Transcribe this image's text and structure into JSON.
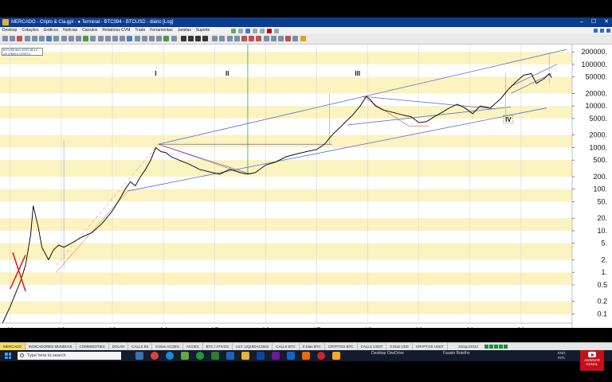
{
  "window": {
    "title": "MERCADO - Cripto & Cia.gpl - ● Terminal - BTC394 - BTCUSD - diário [Log]",
    "controls": [
      "–",
      "☐",
      "✕"
    ]
  },
  "menu": [
    "Desktop",
    "Cotações",
    "Gráficos",
    "Notícias",
    "Calculos",
    "Relatórios CVM",
    "Trade",
    "Ferramentas",
    "Janelas",
    "Suporte"
  ],
  "infobox": {
    "line1": "BTCUSD 6hH 40767.58 1.0",
    "line2": "CH 47809.3 | 47997.4"
  },
  "chart_data": {
    "type": "line",
    "title": "",
    "scale": "log",
    "x_ticks": [
      "11",
      "12",
      "13",
      "14",
      "15",
      "16",
      "17",
      "18",
      "19",
      "20",
      "21"
    ],
    "y_ticks": [
      "200000.",
      "100000.",
      "50000.",
      "20000.",
      "10000.",
      "5000.",
      "2000.",
      "1000.",
      "500.",
      "200.",
      "100.",
      "50.",
      "20.",
      "10.",
      "5.",
      "2.",
      "1.",
      "0.5",
      "0.2",
      "0.1"
    ],
    "y_tick_values": [
      200000,
      100000,
      50000,
      20000,
      10000,
      5000,
      2000,
      1000,
      500,
      200,
      100,
      50,
      20,
      10,
      5,
      2,
      1,
      0.5,
      0.2,
      0.1
    ],
    "ylim": [
      0.06,
      300000
    ],
    "xlim": [
      10.8,
      22
    ],
    "wave_labels": [
      "I",
      "II",
      "III",
      "IV"
    ],
    "series": [
      {
        "x": [
          10.85,
          11.0,
          11.1,
          11.2,
          11.3,
          11.4,
          11.45,
          11.55,
          11.62,
          11.75,
          11.85,
          11.95,
          12.05,
          12.2,
          12.4,
          12.6,
          12.8,
          13.0,
          13.15,
          13.25,
          13.35,
          13.45,
          13.55,
          13.65,
          13.75,
          13.85,
          13.95,
          14.05,
          14.15,
          14.3,
          14.5,
          14.7,
          14.9,
          15.1,
          15.3,
          15.5,
          15.65,
          15.8,
          16.0,
          16.2,
          16.4,
          16.6,
          16.8,
          17.0,
          17.15,
          17.3,
          17.45,
          17.55,
          17.7,
          17.85,
          17.97,
          18.05,
          18.15,
          18.3,
          18.5,
          18.7,
          18.85,
          19.0,
          19.15,
          19.3,
          19.45,
          19.6,
          19.75,
          19.9,
          20.05,
          20.2,
          20.4,
          20.6,
          20.75,
          20.9,
          21.05,
          21.2,
          21.3,
          21.45,
          21.55,
          21.6
        ],
        "y": [
          0.06,
          0.15,
          0.3,
          0.6,
          1.5,
          8,
          40,
          12,
          4,
          2,
          3.5,
          4.5,
          4,
          5,
          7,
          9,
          15,
          30,
          60,
          100,
          150,
          120,
          200,
          300,
          500,
          1000,
          800,
          750,
          600,
          500,
          400,
          300,
          260,
          230,
          300,
          250,
          230,
          250,
          380,
          450,
          600,
          700,
          800,
          900,
          1200,
          2000,
          3000,
          4000,
          6000,
          10000,
          17000,
          14000,
          10000,
          8000,
          7000,
          6000,
          5500,
          4000,
          4200,
          5500,
          7000,
          9000,
          11000,
          9000,
          6500,
          10000,
          9000,
          15000,
          25000,
          38000,
          55000,
          60000,
          35000,
          45000,
          60000,
          48000
        ]
      }
    ]
  },
  "bottom_tabs": [
    "MERCADO",
    "INDICADORES MUNDIAIS",
    "COMMODITIES",
    "DOLAR",
    "CALLS B3",
    "0 Dias ACOES",
    "ACOES",
    "BTC / ATIVOS",
    "ULT. LIQUIDACOES",
    "CALLS BTC",
    "0 Dias BTC",
    "CRYPTOS BTC",
    "CALLS USDT",
    "0 Dias USD",
    "CRYPTOS USDT"
  ],
  "status_date": "26/ago/2022",
  "taskbar": {
    "search_placeholder": "Type here to search",
    "app1": "Desktop   OneDrive",
    "app2": "Fausto Botelho",
    "tray_lang": "ENG",
    "tray_region": "INTL",
    "tray_time": "26/..."
  },
  "channel_badge": "ASSINAR CANAL"
}
